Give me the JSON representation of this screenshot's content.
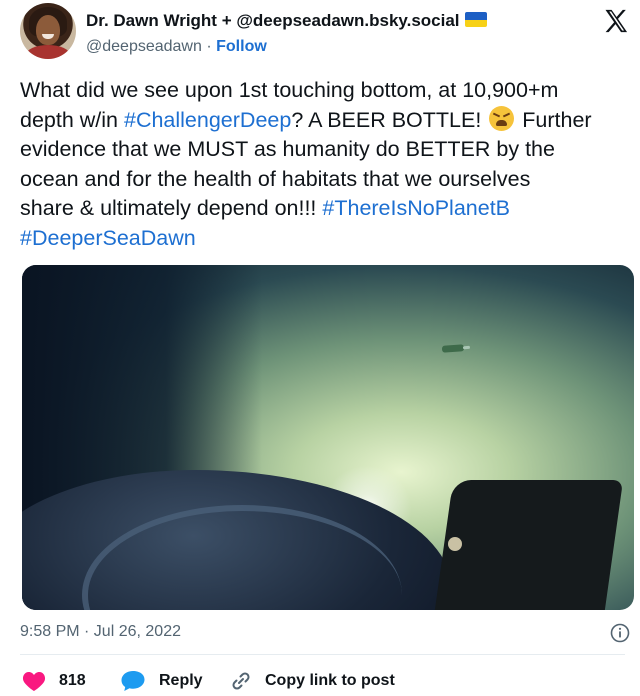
{
  "author": {
    "display_name": "Dr. Dawn Wright + @deepseadawn.bsky.social",
    "handle": "@deepseadawn",
    "separator": "·",
    "follow_label": "Follow",
    "flag_icon": "ukraine-flag-icon",
    "avatar_icon": "avatar"
  },
  "platform_icon": "x-logo-icon",
  "tweet": {
    "lines": [
      {
        "text": "What did we see upon 1st touching bottom, at 10,900+m"
      },
      {
        "pre": "depth w/in ",
        "tag": "#ChallengerDeep",
        "post": "? A BEER BOTTLE! ",
        "emoji": "tired-face-emoji",
        "post2": " Further"
      },
      {
        "text": "evidence that we MUST as humanity do BETTER by the"
      },
      {
        "text": "ocean and for the health of habitats that we ourselves"
      },
      {
        "pre": "share & ultimately depend on!!! ",
        "tag": "#ThereIsNoPlanetB"
      },
      {
        "tag": "#DeeperSeaDawn"
      }
    ]
  },
  "media": {
    "alt": "seafloor-photo"
  },
  "timestamp": "9:58 PM · Jul 26, 2022",
  "info_icon": "info-icon",
  "actions": {
    "like_count": "818",
    "reply_label": "Reply",
    "copy_label": "Copy link to post"
  },
  "colors": {
    "link": "#1d6fd1",
    "like": "#f91880",
    "reply_icon": "#1d9bf0",
    "muted": "#536471"
  }
}
